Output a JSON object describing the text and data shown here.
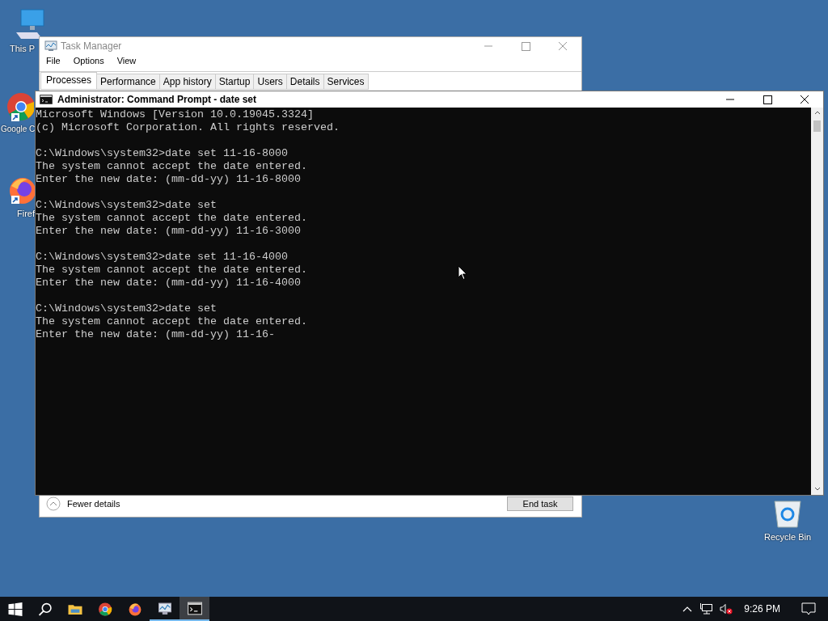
{
  "desktop": {
    "icons": [
      {
        "kind": "computer",
        "label": "This P",
        "shortcut": false
      },
      {
        "kind": "chrome",
        "label": "Google C",
        "shortcut": true
      },
      {
        "kind": "firefox",
        "label": "Firef",
        "shortcut": true
      },
      {
        "kind": "recycle",
        "label": "Recycle Bin",
        "shortcut": false
      }
    ]
  },
  "task_manager": {
    "title": "Task Manager",
    "active": false,
    "menu": [
      "File",
      "Options",
      "View"
    ],
    "tabs": [
      {
        "label": "Processes",
        "selected": true
      },
      {
        "label": "Performance",
        "selected": false
      },
      {
        "label": "App history",
        "selected": false
      },
      {
        "label": "Startup",
        "selected": false
      },
      {
        "label": "Users",
        "selected": false
      },
      {
        "label": "Details",
        "selected": false
      },
      {
        "label": "Services",
        "selected": false
      }
    ],
    "footer": {
      "toggle": "Fewer details",
      "button": "End task"
    }
  },
  "command_prompt": {
    "title": "Administrator: Command Prompt - date  set",
    "active": true,
    "blocks": [
      [
        "Microsoft Windows [Version 10.0.19045.3324]",
        "(c) Microsoft Corporation. All rights reserved."
      ],
      [
        "C:\\Windows\\system32>date set 11-16-8000",
        "The system cannot accept the date entered.",
        "Enter the new date: (mm-dd-yy) 11-16-8000"
      ],
      [
        "C:\\Windows\\system32>date set",
        "The system cannot accept the date entered.",
        "Enter the new date: (mm-dd-yy) 11-16-3000"
      ],
      [
        "C:\\Windows\\system32>date set 11-16-4000",
        "The system cannot accept the date entered.",
        "Enter the new date: (mm-dd-yy) 11-16-4000"
      ],
      [
        "C:\\Windows\\system32>date set",
        "The system cannot accept the date entered.",
        "Enter the new date: (mm-dd-yy) 11-16-"
      ]
    ]
  },
  "taskbar": {
    "items": [
      {
        "kind": "start",
        "running": false,
        "selected": false
      },
      {
        "kind": "search",
        "running": false,
        "selected": false
      },
      {
        "kind": "explorer",
        "running": false,
        "selected": false
      },
      {
        "kind": "chrome",
        "running": false,
        "selected": false
      },
      {
        "kind": "firefox",
        "running": false,
        "selected": false
      },
      {
        "kind": "taskmgr",
        "running": true,
        "selected": false
      },
      {
        "kind": "cmd",
        "running": true,
        "selected": true
      }
    ],
    "tray": {
      "volume_muted": true,
      "clock": "9:26 PM"
    }
  }
}
